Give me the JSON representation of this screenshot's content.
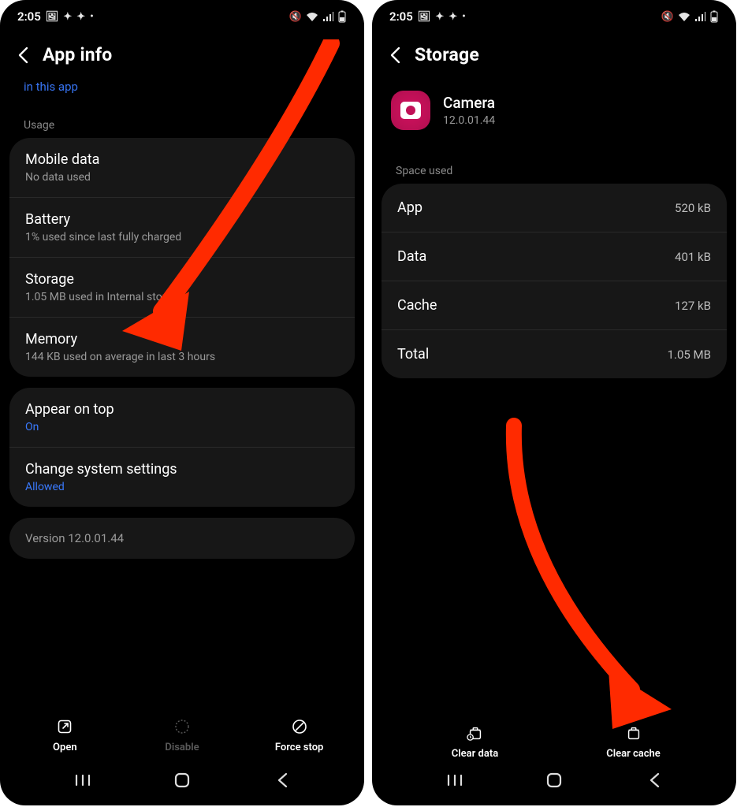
{
  "statusbar": {
    "time": "2:05"
  },
  "left": {
    "title": "App info",
    "cutoff_link": "in this app",
    "section_usage": "Usage",
    "rows": {
      "mobile_data": {
        "title": "Mobile data",
        "sub": "No data used"
      },
      "battery": {
        "title": "Battery",
        "sub": "1% used since last fully charged"
      },
      "storage": {
        "title": "Storage",
        "sub": "1.05 MB used in Internal storage"
      },
      "memory": {
        "title": "Memory",
        "sub": "144 KB used on average in last 3 hours"
      },
      "appear": {
        "title": "Appear on top",
        "sub": "On"
      },
      "change_sys": {
        "title": "Change system settings",
        "sub": "Allowed"
      }
    },
    "version_row": "Version 12.0.01.44",
    "bottom": {
      "open": "Open",
      "disable": "Disable",
      "force": "Force stop"
    }
  },
  "right": {
    "title": "Storage",
    "app": {
      "name": "Camera",
      "version": "12.0.01.44"
    },
    "section_space": "Space used",
    "rows": {
      "app": {
        "k": "App",
        "v": "520 kB"
      },
      "data": {
        "k": "Data",
        "v": "401 kB"
      },
      "cache": {
        "k": "Cache",
        "v": "127 kB"
      },
      "total": {
        "k": "Total",
        "v": "1.05 MB"
      }
    },
    "bottom": {
      "clear_data": "Clear data",
      "clear_cache": "Clear cache"
    }
  }
}
